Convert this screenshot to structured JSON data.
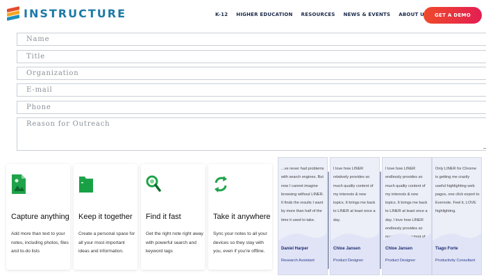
{
  "header": {
    "logo_text": "INSTRUCTURE",
    "nav": [
      "K-12",
      "HIGHER EDUCATION",
      "RESOURCES",
      "NEWS & EVENTS",
      "ABOUT US"
    ],
    "cta_label": "GET A DEMO"
  },
  "form": {
    "name_placeholder": "Name",
    "title_placeholder": "Title",
    "organization_placeholder": "Organization",
    "email_placeholder": "E-mail",
    "phone_placeholder": "Phone",
    "reason_placeholder": "Reason for Outreach"
  },
  "features": [
    {
      "title": "Capture anything",
      "desc": "Add more than text to your notes, including photos, files and to-do lists",
      "icon": "capture-icon"
    },
    {
      "title": "Keep it together",
      "desc": "Create a personal space for all your most important ideas and information.",
      "icon": "folder-icon"
    },
    {
      "title": "Find it fast",
      "desc": "Get the right note right away with powerful search and keyword tags",
      "icon": "search-icon"
    },
    {
      "title": "Take it anywhere",
      "desc": "Sync your notes to all your devices so they stay with you, even if you're offline.",
      "icon": "sync-icon"
    }
  ],
  "testimonials": [
    {
      "quote": "...ve never had problems with search engines. But now I cannot imagine browsing without LINER. It finds the results I want by more than half of the time it used to take.",
      "name": "Daniel Harper",
      "role": "Research Assistant"
    },
    {
      "quote": "I love how LINER relatively provides so much quality content of my interests & new topics. It brings me back to LINER at least once a day.",
      "name": "Chloe Jansen",
      "role": "Product Designer"
    },
    {
      "quote": "I love how LINER endlessly provides so much quality content of my interests & new topics. It brings me back to LINER at least once a day. I love how LINER endlessly provides so much quality content of my...",
      "name": "Chloe Jansen",
      "role": "Product Designer"
    },
    {
      "quote": "Only LINER for Chrome is getting me crazily useful highlighting web pages, one click export to Evernote. Feel it, LOVE highlighting.",
      "name": "Tiago Forte",
      "role": "Productivity Consultant"
    }
  ],
  "colors": {
    "brand_blue": "#1d79a7",
    "nav_text": "#1b2a4a",
    "cta_gradient_start": "#ef4a2a",
    "cta_gradient_end": "#e31e52",
    "feature_icon_green": "#1fa34a"
  }
}
